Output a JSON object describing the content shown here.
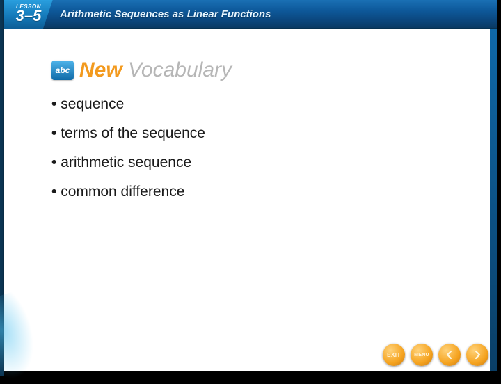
{
  "header": {
    "lesson_label": "LESSON",
    "lesson_number": "3–5",
    "title": "Arithmetic Sequences as Linear Functions"
  },
  "vocab_logo": {
    "badge_text": "abc",
    "new_text": "New",
    "vocab_text": " Vocabulary"
  },
  "bullets": [
    "sequence",
    "terms of the sequence",
    "arithmetic sequence",
    "common difference"
  ],
  "footer": {
    "exit_label": "EXIT",
    "menu_label": "MENU"
  }
}
